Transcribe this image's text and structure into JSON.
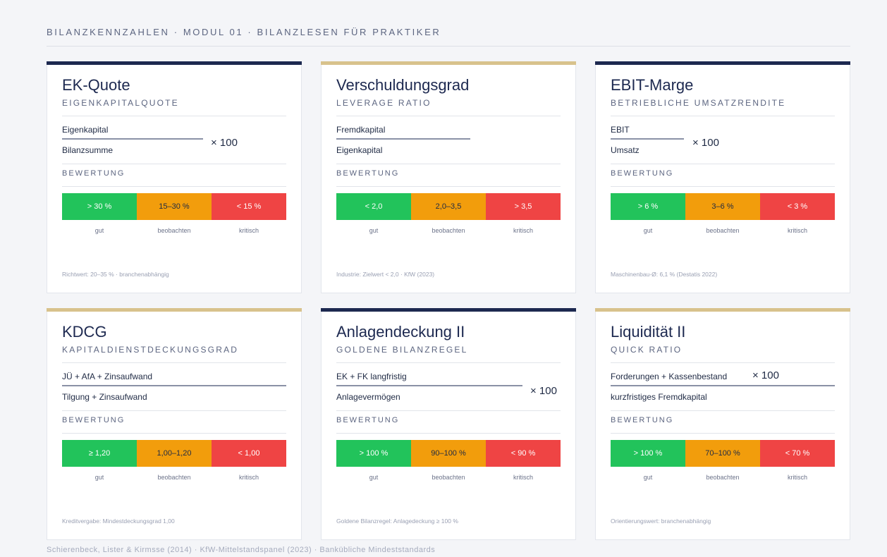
{
  "header": {
    "title": "BILANZKENNZAHLEN · MODUL 01 · BILANZLESEN FÜR PRAKTIKER"
  },
  "cards": [
    {
      "title": "EK-Quote",
      "subtitle": "EIGENKAPITALQUOTE",
      "numerator": "Eigenkapital",
      "denominator": "Bilanzsumme",
      "multiplier": "× 100",
      "evaluation_label": "BEWERTUNG",
      "zones": [
        "> 30 %",
        "15–30 %",
        "< 15 %"
      ],
      "zone_labels": [
        "gut",
        "beobachten",
        "kritisch"
      ],
      "note": "Richtwert: 20–35 % · branchenabhängig"
    },
    {
      "title": "Verschuldungsgrad",
      "subtitle": "LEVERAGE RATIO",
      "numerator": "Fremdkapital",
      "denominator": "Eigenkapital",
      "multiplier": "",
      "evaluation_label": "BEWERTUNG",
      "zones": [
        "< 2,0",
        "2,0–3,5",
        "> 3,5"
      ],
      "zone_labels": [
        "gut",
        "beobachten",
        "kritisch"
      ],
      "note": "Industrie: Zielwert < 2,0 · KfW (2023)"
    },
    {
      "title": "EBIT-Marge",
      "subtitle": "BETRIEBLICHE UMSATZRENDITE",
      "numerator": "EBIT",
      "denominator": "Umsatz",
      "multiplier": "× 100",
      "evaluation_label": "BEWERTUNG",
      "zones": [
        "> 6 %",
        "3–6 %",
        "< 3 %"
      ],
      "zone_labels": [
        "gut",
        "beobachten",
        "kritisch"
      ],
      "note": "Maschinenbau-Ø: 6,1 % (Destatis 2022)"
    },
    {
      "title": "KDCG",
      "subtitle": "KAPITALDIENSTDECKUNGSGRAD",
      "numerator": "JÜ + AfA + Zinsaufwand",
      "denominator": "Tilgung + Zinsaufwand",
      "multiplier": "",
      "evaluation_label": "BEWERTUNG",
      "zones": [
        "≥ 1,20",
        "1,00–1,20",
        "< 1,00"
      ],
      "zone_labels": [
        "gut",
        "beobachten",
        "kritisch"
      ],
      "note": "Kreditvergabe: Mindestdeckungsgrad 1,00"
    },
    {
      "title": "Anlagendeckung II",
      "subtitle": "GOLDENE BILANZREGEL",
      "numerator": "EK + FK langfristig",
      "denominator": "Anlagevermögen",
      "multiplier": "× 100",
      "evaluation_label": "BEWERTUNG",
      "zones": [
        "> 100 %",
        "90–100 %",
        "< 90 %"
      ],
      "zone_labels": [
        "gut",
        "beobachten",
        "kritisch"
      ],
      "note": "Goldene Bilanzregel: Anlagedeckung ≥ 100 %"
    },
    {
      "title": "Liquidität II",
      "subtitle": "QUICK RATIO",
      "numerator": "Forderungen + Kassenbestand",
      "denominator": "kurzfristiges Fremdkapital",
      "multiplier": "× 100",
      "evaluation_label": "BEWERTUNG",
      "zones": [
        "> 100 %",
        "70–100 %",
        "< 70 %"
      ],
      "zone_labels": [
        "gut",
        "beobachten",
        "kritisch"
      ],
      "note": "Orientierungswert: branchenabhängig"
    }
  ],
  "footer": {
    "sources": "Schierenbeck, Lister & Kirmsse (2014) · KfW-Mittelstandspanel (2023) · Bankübliche Mindeststandards"
  }
}
